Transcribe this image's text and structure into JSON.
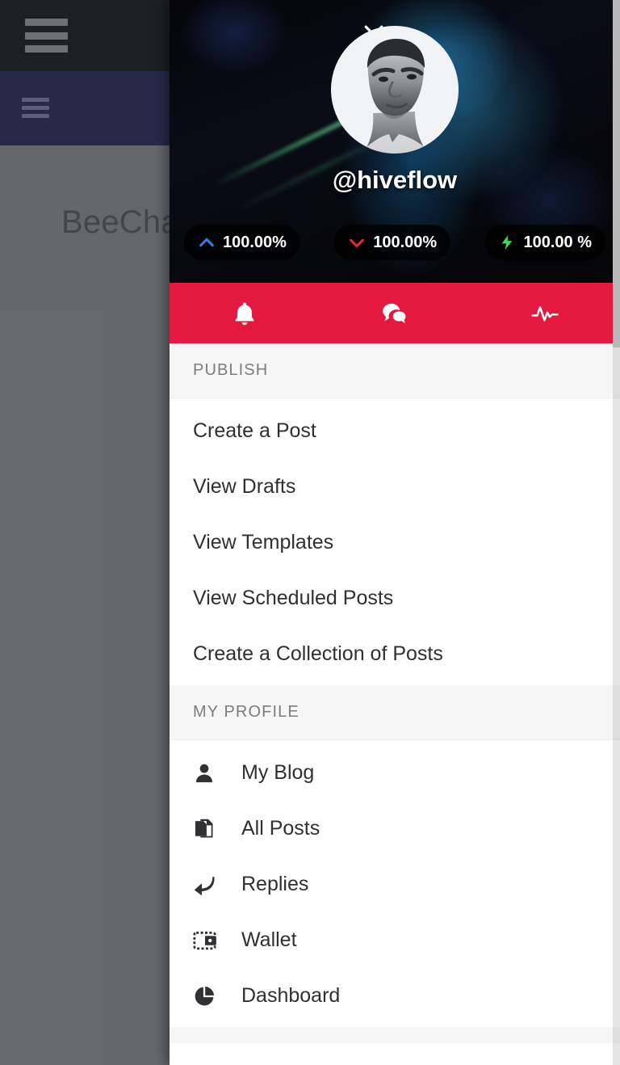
{
  "background": {
    "app_title": "BeeCha",
    "hamburger_label": "menu",
    "sub_hamburger_label": "menu"
  },
  "drawer": {
    "close_label": "Close",
    "profile": {
      "handle": "@hiveflow",
      "avatar_alt": "hiveflow avatar",
      "stats": [
        {
          "id": "upvote",
          "icon": "chevron-up-icon",
          "value": "100.00%",
          "color": "#2f7fd4"
        },
        {
          "id": "downvote",
          "icon": "chevron-down-icon",
          "value": "100.00%",
          "color": "#e02b2b"
        },
        {
          "id": "resource-credits",
          "icon": "lightning-bolt-icon",
          "value": "100.00 %",
          "color": "#3cd95a"
        }
      ]
    },
    "action_bar": {
      "background": "#e3193f",
      "actions": [
        {
          "id": "notifications",
          "icon": "bell-icon",
          "label": "Notifications"
        },
        {
          "id": "replies",
          "icon": "comments-icon",
          "label": "Replies"
        },
        {
          "id": "activity",
          "icon": "pulse-icon",
          "label": "Activity"
        }
      ]
    },
    "sections": [
      {
        "id": "publish",
        "title": "PUBLISH",
        "items": [
          {
            "id": "create-a-post",
            "label": "Create a Post",
            "icon": null
          },
          {
            "id": "view-drafts",
            "label": "View Drafts",
            "icon": null
          },
          {
            "id": "view-templates",
            "label": "View Templates",
            "icon": null
          },
          {
            "id": "view-scheduled-posts",
            "label": "View Scheduled Posts",
            "icon": null
          },
          {
            "id": "create-a-collection-of-posts",
            "label": "Create a Collection of Posts",
            "icon": null
          }
        ]
      },
      {
        "id": "my-profile",
        "title": "MY PROFILE",
        "items": [
          {
            "id": "my-blog",
            "label": "My Blog",
            "icon": "person-icon"
          },
          {
            "id": "all-posts",
            "label": "All Posts",
            "icon": "documents-icon"
          },
          {
            "id": "replies",
            "label": "Replies",
            "icon": "reply-arrow-icon"
          },
          {
            "id": "wallet",
            "label": "Wallet",
            "icon": "wallet-icon"
          },
          {
            "id": "dashboard",
            "label": "Dashboard",
            "icon": "pie-chart-icon"
          }
        ]
      }
    ]
  }
}
